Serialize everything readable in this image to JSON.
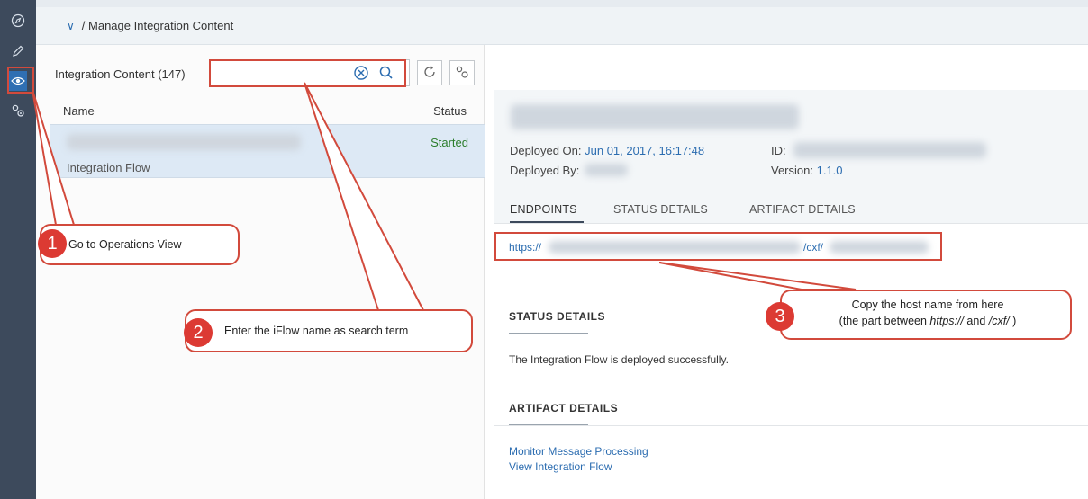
{
  "breadcrumb": {
    "text": "/ Manage Integration Content"
  },
  "content_list": {
    "title": "Integration Content (147)",
    "search_value": "",
    "columns": {
      "name": "Name",
      "status": "Status"
    },
    "rows": [
      {
        "type": "Integration Flow",
        "status": "Started"
      }
    ]
  },
  "details": {
    "deployed_on_label": "Deployed On:",
    "deployed_on_value": "Jun 01, 2017, 16:17:48",
    "deployed_by_label": "Deployed By:",
    "id_label": "ID:",
    "version_label": "Version:",
    "version_value": "1.1.0",
    "tabs": [
      "ENDPOINTS",
      "STATUS DETAILS",
      "ARTIFACT DETAILS"
    ],
    "endpoint_prefix": "https://",
    "endpoint_middle": "/cxf/",
    "status_heading": "STATUS DETAILS",
    "status_text": "The Integration Flow is deployed successfully.",
    "artifact_heading": "ARTIFACT DETAILS",
    "links": [
      "Monitor Message Processing",
      "View Integration Flow"
    ]
  },
  "callouts": {
    "c1": {
      "number": "1",
      "text": "Go to Operations View"
    },
    "c2": {
      "number": "2",
      "text": "Enter the iFlow name as search term"
    },
    "c3": {
      "number": "3",
      "line1": "Copy the host name from here",
      "line2_pre": "(the part between ",
      "line2_a": "https://",
      "line2_mid": " and ",
      "line2_b": "/cxf/",
      "line2_post": " )"
    }
  },
  "colors": {
    "accent": "#2b6cb0",
    "callout_red": "#d24a3c",
    "status_green": "#2b7d2b",
    "rail": "#3d4a5c"
  },
  "icons": [
    "discover-icon",
    "design-pencil-icon",
    "monitor-eye-icon",
    "settings-gears-icon",
    "chevron-down-icon",
    "clear-icon",
    "search-icon",
    "refresh-icon",
    "settings-icon"
  ]
}
